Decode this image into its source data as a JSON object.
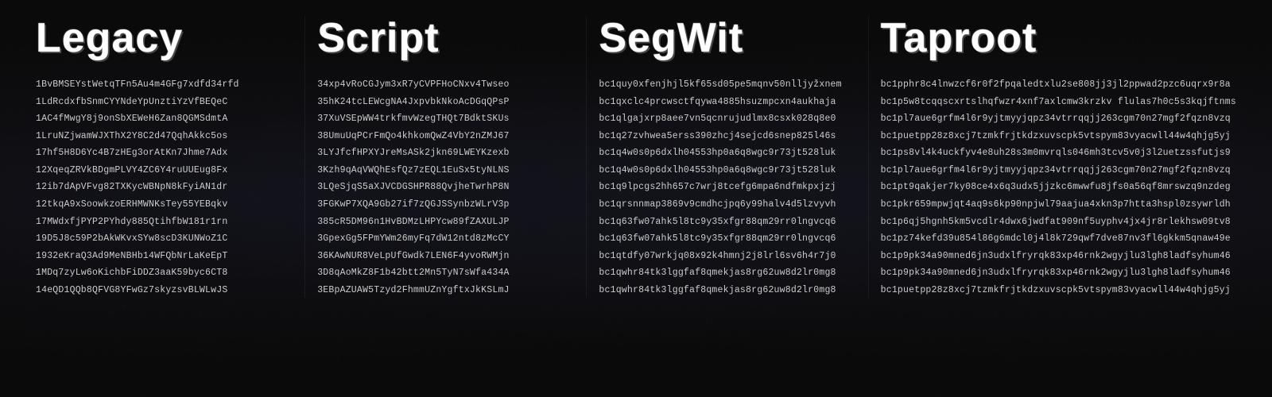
{
  "columns": [
    {
      "id": "legacy",
      "title": "Legacy",
      "addresses": [
        "1BvBMSEYstWetqTFn5Au4m4GFg7xdfd34rfd",
        "1LdRcdxfbSnmCYYNdeYpUnztiYzVfBEQeC",
        "1AC4fMwgY8j9onSbXEWeH6Zan8QGMSdmtA",
        "1LruNZjwamWJXThX2Y8C2d47QqhAkkc5os",
        "17hf5H8D6Yc4B7zHEg3orAtKn7Jhme7Adx",
        "12XqeqZRVkBDgmPLVY4ZC6Y4ruUUEug8Fx",
        "12ib7dApVFvg82TXKycWBNpN8kFyiAN1dr",
        "12tkqA9xSoowkzoERHMWNKsTey55YEBqkv",
        "17MWdxfjPYP2PYhdy885QtihfbW181r1rn",
        "19D5J8c59P2bAkWKvxSYw8scD3KUNWoZ1C",
        "1932eKraQ3Ad9MeNBHb14WFQbNrLaKeEpT",
        "1MDq7zyLw6oKichbFiDDZ3aaK59byc6CT8",
        "14eQD1QQb8QFVG8YFwGz7skyzsvBLWLwJS"
      ]
    },
    {
      "id": "script",
      "title": "Script",
      "addresses": [
        "34xp4vRoCGJym3xR7yCVPFHoCNxv4Twseo",
        "35hK24tcLEWcgNA4JxpvbkNkoAcDGqQPsP",
        "37XuVSEpWW4trkfmvWzegTHQt7BdktSKUs",
        "38UmuUqPCrFmQo4khkomQwZ4VbY2nZMJ67",
        "3LYJfcfHPXYJreMsASk2jkn69LWEYKzexb",
        "3Kzh9qAqVWQhEsfQz7zEQL1EuSx5tyNLNS",
        "3LQeSjqS5aXJVCDGSHPR88QvjheTwrhP8N",
        "3FGKwP7XQA9Gb27if7zQGJSSynbzWLrV3p",
        "385cR5DM96n1HvBDMzLHPYcw89fZAXULJP",
        "3GpexGg5FPmYWm26myFq7dW12ntd8zMcCY",
        "36KAwNUR8VeLpUfGwdk7LEN6F4yvoRWMjn",
        "3D8qAoMkZ8F1b42btt2Mn5TyN7sWfa434A",
        "3EBpAZUAW5Tzyd2FhmmUZnYgftxJkKSLmJ"
      ]
    },
    {
      "id": "segwit",
      "title": "SegWit",
      "addresses": [
        "bc1quy0xfenjhjl5kf65sd05pe5mqnv50nlljyžxnem",
        "bc1qxclc4prcwsctfqywa4885hsuzmpcxn4aukhaja",
        "bc1qlgajxrp8aee7vn5qcnrujudlmx8csxk028q8e0",
        "bc1q27zvhwea5erss390zhcj4sejcd6snep825l46s",
        "bc1q4w0s0p6dxlh04553hp0a6q8wgc9r73jt528luk",
        "bc1q4w0s0p6dxlh04553hp0a6q8wgc9r73jt528luk",
        "bc1q9lpcgs2hh657c7wrj8tcefg6mpa6ndfmkpxjzj",
        "bc1qrsnnmap3869v9cmdhcjpq6y99halv4d5lzvyvh",
        "bc1q63fw07ahk5l8tc9y35xfgr88qm29rr0lngvcq6",
        "bc1q63fw07ahk5l8tc9y35xfgr88qm29rr0lngvcq6",
        "bc1qtdfy07wrkjq08x92k4hmnj2j8lrl6sv6h4r7j0",
        "bc1qwhr84tk3lggfaf8qmekjas8rg62uw8d2lr0mg8",
        "bc1qwhr84tk3lggfaf8qmekjas8rg62uw8d2lr0mg8"
      ]
    },
    {
      "id": "taproot",
      "title": "Taproot",
      "addresses": [
        "bc1pphr8c4lnwzcf6r0f2fpqaledtxlu2se808jj3jl2ppwad2pzc6uqrx9r8a",
        "bc1p5w8tcqqscxrtslhqfwzr4xnf7axlcmw3krzkv flulas7h0c5s3kqjftnms",
        "bc1pl7aue6grfm4l6r9yjtmyyjqpz34vtrrqqjj263cgm70n27mgf2fqzn8vzq",
        "bc1puetpp28z8xcj7tzmkfrjtkdzxuvscpk5vtspym83vyacwll44w4qhjg5yj",
        "bc1ps8vl4k4uckfyv4e8uh28s3m0mvrqls046mh3tcv5v0j3l2uetzssfutjs9",
        "bc1pl7aue6grfm4l6r9yjtmyyjqpz34vtrrqqjj263cgm70n27mgf2fqzn8vzq",
        "bc1pt9qakjer7ky08ce4x6q3udx5jjzkc6mwwfu8jfs0a56qf8mrswzq9nzdeg",
        "bc1pkr659mpwjqt4aq9s6kp90npjwl79aajua4xkn3p7htta3hspl0zsywrldh",
        "bc1p6qj5hgnh5km5vcdlr4dwx6jwdfat909nf5uyphv4jx4jr8rlekhsw09tv8",
        "bc1pz74kefd39u854l86g6mdcl0j4l8k729qwf7dve87nv3fl6gkkm5qnaw49e",
        "bc1p9pk34a90mned6jn3udxlfryrqk83xp46rnk2wgyjlu3lgh8ladfsyhum46",
        "bc1p9pk34a90mned6jn3udxlfryrqk83xp46rnk2wgyjlu3lgh8ladfsyhum46",
        "bc1puetpp28z8xcj7tzmkfrjtkdzxuvscpk5vtspym83vyacwll44w4qhjg5yj"
      ]
    }
  ]
}
